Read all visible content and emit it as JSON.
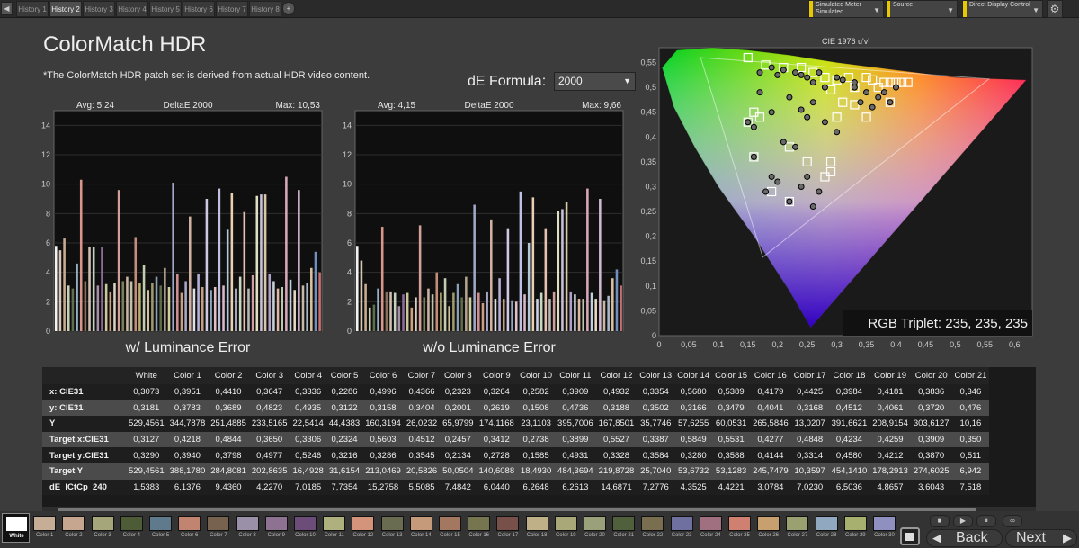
{
  "history": {
    "tabs": [
      "History 1",
      "History 2",
      "History 3",
      "History 4",
      "History 5",
      "History 6",
      "History 7",
      "History 8"
    ],
    "active": 1,
    "add_label": "+",
    "back_arrow": "◀"
  },
  "controls": {
    "meter_line1": "Simulated Meter",
    "meter_line2": "Simulated",
    "source": "Source",
    "display": "Direct Display Control",
    "gear": "⚙"
  },
  "header": {
    "title": "ColorMatch HDR",
    "note": "*The ColorMatch HDR patch set is derived from actual HDR video content.",
    "de_formula_label": "dE Formula:",
    "de_formula_value": "2000"
  },
  "chart_data": [
    {
      "type": "bar",
      "title": "DeltaE 2000",
      "avg": "Avg: 5,24",
      "max": "Max: 10,53",
      "xlabel": "w/ Luminance Error",
      "ylim": [
        0,
        15
      ],
      "yticks": [
        0,
        2,
        4,
        6,
        8,
        10,
        12,
        14
      ],
      "values": [
        5.8,
        5.5,
        6.3,
        3.1,
        2.9,
        4.6,
        10.3,
        3.4,
        5.7,
        5.7,
        3.1,
        5.7,
        3.2,
        2.7,
        3.3,
        9.6,
        3.4,
        3.7,
        3.4,
        6.4,
        3.3,
        4.5,
        2.8,
        3.3,
        3.7,
        3.1,
        4.3,
        3.0,
        10.1,
        3.9,
        2.6,
        3.4,
        7.8,
        2.9,
        3.9,
        3.0,
        9.0,
        2.8,
        3.0,
        9.7,
        3.1,
        6.9,
        9.4,
        2.9,
        3.7,
        8.1,
        2.9,
        3.8,
        9.2,
        9.3,
        9.3,
        3.9,
        3.4,
        2.9,
        3.0,
        10.5,
        3.5,
        2.8,
        9.6,
        3.1,
        3.3,
        4.3,
        5.4,
        4.0
      ],
      "colors": [
        "#f3f3f3",
        "#d8c6b6",
        "#c9ad90",
        "#c8d0b8",
        "#5d6e4a",
        "#95b0c8",
        "#d8968a",
        "#8b6e5a",
        "#cfc0b0",
        "#c6d0c0",
        "#a58fa8",
        "#8d6c9a",
        "#c8c898",
        "#cea080",
        "#d8d0c0",
        "#d2a098",
        "#78805a",
        "#c8b4a0",
        "#bec0a8",
        "#c68c7a",
        "#b8b070",
        "#c4ccb0",
        "#d0c4a0",
        "#a09a6a",
        "#8aa0b8",
        "#5f6a48",
        "#b2a290",
        "#cfcf9a",
        "#a0a8c8",
        "#d09090",
        "#c8a080",
        "#a8a8c8",
        "#d0b0a0",
        "#e0e0e0",
        "#b8b0d8",
        "#c0a080",
        "#d0c8e0",
        "#90a8c0",
        "#e0c0c0",
        "#c0c0e0",
        "#d8b8c8",
        "#b0c8d8",
        "#e8d0b0",
        "#d0d0e8",
        "#c8d8c0",
        "#e8c0b0",
        "#b8b8b8",
        "#d0a0a0",
        "#e0e0c0",
        "#c8c0d8",
        "#d8c8a8",
        "#b0a0c8",
        "#c8d0d8",
        "#e0b8a0",
        "#b8c8b0",
        "#d8a8b8",
        "#c0d0e0",
        "#e8d8c0",
        "#d0b8d0",
        "#c8b8a8",
        "#a8b8c8",
        "#d8c0a0",
        "#7090c0",
        "#c87070"
      ]
    },
    {
      "type": "bar",
      "title": "DeltaE 2000",
      "avg": "Avg: 4,15",
      "max": "Max: 9,66",
      "xlabel": "w/o Luminance Error",
      "ylim": [
        0,
        15
      ],
      "yticks": [
        0,
        2,
        4,
        6,
        8,
        10,
        12,
        14
      ],
      "values": [
        5.8,
        4.8,
        3.2,
        1.6,
        1.8,
        2.9,
        7.1,
        2.7,
        2.7,
        2.6,
        1.7,
        2.5,
        2.6,
        1.6,
        2.3,
        7.2,
        2.3,
        2.9,
        2.5,
        4.0,
        2.6,
        3.6,
        1.7,
        2.6,
        3.2,
        2.3,
        3.7,
        2.3,
        8.6,
        2.6,
        1.9,
        2.7,
        7.6,
        2.2,
        3.6,
        2.2,
        7.0,
        2.1,
        2.0,
        9.5,
        2.5,
        6.0,
        9.1,
        2.2,
        2.6,
        7.0,
        2.2,
        2.7,
        8.2,
        8.3,
        8.8,
        2.7,
        2.5,
        2.2,
        2.2,
        9.7,
        2.6,
        2.2,
        9.0,
        2.1,
        2.4,
        3.6,
        4.2,
        3.1
      ],
      "colors": [
        "#f3f3f3",
        "#d8c6b6",
        "#c9ad90",
        "#c8d0b8",
        "#5d6e4a",
        "#95b0c8",
        "#d8968a",
        "#8b6e5a",
        "#cfc0b0",
        "#c6d0c0",
        "#a58fa8",
        "#8d6c9a",
        "#c8c898",
        "#cea080",
        "#d8d0c0",
        "#d2a098",
        "#78805a",
        "#c8b4a0",
        "#bec0a8",
        "#c68c7a",
        "#b8b070",
        "#c4ccb0",
        "#d0c4a0",
        "#a09a6a",
        "#8aa0b8",
        "#5f6a48",
        "#b2a290",
        "#cfcf9a",
        "#a0a8c8",
        "#d09090",
        "#c8a080",
        "#a8a8c8",
        "#d0b0a0",
        "#e0e0e0",
        "#b8b0d8",
        "#c0a080",
        "#d0c8e0",
        "#90a8c0",
        "#e0c0c0",
        "#c0c0e0",
        "#d8b8c8",
        "#b0c8d8",
        "#e8d0b0",
        "#d0d0e8",
        "#c8d8c0",
        "#e8c0b0",
        "#b8b8b8",
        "#d0a0a0",
        "#e0e0c0",
        "#c8c0d8",
        "#d8c8a8",
        "#b0a0c8",
        "#c8d0d8",
        "#e0b8a0",
        "#b8c8b0",
        "#d8a8b8",
        "#c0d0e0",
        "#e8d8c0",
        "#d0b8d0",
        "#c8b8a8",
        "#a8b8c8",
        "#d8c0a0",
        "#7090c0",
        "#c87070"
      ]
    },
    {
      "type": "scatter",
      "title": "CIE 1976 u'v'",
      "xlim": [
        0,
        0.63
      ],
      "ylim": [
        0,
        0.58
      ],
      "xticks": [
        "0",
        "0,05",
        "0,1",
        "0,15",
        "0,2",
        "0,25",
        "0,3",
        "0,35",
        "0,4",
        "0,45",
        "0,5",
        "0,55",
        "0,6"
      ],
      "yticks": [
        "0",
        "0,05",
        "0,1",
        "0,15",
        "0,2",
        "0,25",
        "0,3",
        "0,35",
        "0,4",
        "0,45",
        "0,5",
        "0,55"
      ],
      "triplet_label": "RGB Triplet: 235, 235, 235",
      "measured": [
        [
          0.17,
          0.53
        ],
        [
          0.19,
          0.54
        ],
        [
          0.2,
          0.525
        ],
        [
          0.21,
          0.535
        ],
        [
          0.23,
          0.53
        ],
        [
          0.24,
          0.525
        ],
        [
          0.25,
          0.52
        ],
        [
          0.26,
          0.51
        ],
        [
          0.27,
          0.53
        ],
        [
          0.28,
          0.5
        ],
        [
          0.3,
          0.52
        ],
        [
          0.31,
          0.515
        ],
        [
          0.33,
          0.5
        ],
        [
          0.34,
          0.47
        ],
        [
          0.35,
          0.49
        ],
        [
          0.37,
          0.48
        ],
        [
          0.38,
          0.49
        ],
        [
          0.4,
          0.5
        ],
        [
          0.17,
          0.49
        ],
        [
          0.16,
          0.42
        ],
        [
          0.19,
          0.45
        ],
        [
          0.22,
          0.48
        ],
        [
          0.24,
          0.455
        ],
        [
          0.25,
          0.44
        ],
        [
          0.26,
          0.47
        ],
        [
          0.28,
          0.43
        ],
        [
          0.3,
          0.41
        ],
        [
          0.21,
          0.39
        ],
        [
          0.23,
          0.38
        ],
        [
          0.16,
          0.36
        ],
        [
          0.19,
          0.32
        ],
        [
          0.2,
          0.31
        ],
        [
          0.24,
          0.3
        ],
        [
          0.25,
          0.32
        ],
        [
          0.27,
          0.29
        ],
        [
          0.26,
          0.26
        ],
        [
          0.22,
          0.27
        ],
        [
          0.18,
          0.29
        ],
        [
          0.15,
          0.43
        ],
        [
          0.33,
          0.51
        ],
        [
          0.36,
          0.46
        ],
        [
          0.39,
          0.47
        ]
      ],
      "targets": [
        [
          0.15,
          0.56
        ],
        [
          0.18,
          0.545
        ],
        [
          0.21,
          0.54
        ],
        [
          0.24,
          0.54
        ],
        [
          0.26,
          0.53
        ],
        [
          0.28,
          0.52
        ],
        [
          0.3,
          0.515
        ],
        [
          0.32,
          0.52
        ],
        [
          0.33,
          0.5
        ],
        [
          0.35,
          0.52
        ],
        [
          0.36,
          0.515
        ],
        [
          0.38,
          0.51
        ],
        [
          0.4,
          0.51
        ],
        [
          0.42,
          0.51
        ],
        [
          0.29,
          0.495
        ],
        [
          0.31,
          0.47
        ],
        [
          0.33,
          0.465
        ],
        [
          0.35,
          0.44
        ],
        [
          0.39,
          0.47
        ],
        [
          0.41,
          0.51
        ],
        [
          0.16,
          0.45
        ],
        [
          0.17,
          0.44
        ],
        [
          0.16,
          0.36
        ],
        [
          0.22,
          0.38
        ],
        [
          0.25,
          0.35
        ],
        [
          0.29,
          0.35
        ],
        [
          0.28,
          0.32
        ],
        [
          0.29,
          0.33
        ],
        [
          0.19,
          0.29
        ],
        [
          0.22,
          0.27
        ],
        [
          0.15,
          0.43
        ],
        [
          0.37,
          0.5
        ],
        [
          0.3,
          0.44
        ],
        [
          0.39,
          0.51
        ]
      ]
    }
  ],
  "table": {
    "headers": [
      "",
      "White",
      "Color 1",
      "Color 2",
      "Color 3",
      "Color 4",
      "Color 5",
      "Color 6",
      "Color 7",
      "Color 8",
      "Color 9",
      "Color 10",
      "Color 11",
      "Color 12",
      "Color 13",
      "Color 14",
      "Color 15",
      "Color 16",
      "Color 17",
      "Color 18",
      "Color 19",
      "Color 20",
      "Color 21"
    ],
    "rows": [
      {
        "label": "x: CIE31",
        "values": [
          "0,3073",
          "0,3951",
          "0,4410",
          "0,3647",
          "0,3336",
          "0,2286",
          "0,4996",
          "0,4366",
          "0,2323",
          "0,3264",
          "0,2582",
          "0,3909",
          "0,4932",
          "0,3354",
          "0,5680",
          "0,5389",
          "0,4179",
          "0,4425",
          "0,3984",
          "0,4181",
          "0,3836",
          "0,346"
        ]
      },
      {
        "label": "y: CIE31",
        "values": [
          "0,3181",
          "0,3783",
          "0,3689",
          "0,4823",
          "0,4935",
          "0,3122",
          "0,3158",
          "0,3404",
          "0,2001",
          "0,2619",
          "0,1508",
          "0,4736",
          "0,3188",
          "0,3502",
          "0,3166",
          "0,3479",
          "0,4041",
          "0,3168",
          "0,4512",
          "0,4061",
          "0,3720",
          "0,476"
        ]
      },
      {
        "label": "Y",
        "values": [
          "529,4561",
          "344,7878",
          "251,4885",
          "233,5165",
          "22,5414",
          "44,4383",
          "160,3194",
          "26,0232",
          "65,9799",
          "174,1168",
          "23,1103",
          "395,7006",
          "167,8501",
          "35,7746",
          "57,6255",
          "60,0531",
          "265,5846",
          "13,0207",
          "391,6621",
          "208,9154",
          "303,6127",
          "10,16"
        ]
      },
      {
        "label": "Target x:CIE31",
        "values": [
          "0,3127",
          "0,4218",
          "0,4844",
          "0,3650",
          "0,3306",
          "0,2324",
          "0,5603",
          "0,4512",
          "0,2457",
          "0,3412",
          "0,2738",
          "0,3899",
          "0,5527",
          "0,3387",
          "0,5849",
          "0,5531",
          "0,4277",
          "0,4848",
          "0,4234",
          "0,4259",
          "0,3909",
          "0,350"
        ]
      },
      {
        "label": "Target y:CIE31",
        "values": [
          "0,3290",
          "0,3940",
          "0,3798",
          "0,4977",
          "0,5246",
          "0,3216",
          "0,3286",
          "0,3545",
          "0,2134",
          "0,2728",
          "0,1585",
          "0,4931",
          "0,3328",
          "0,3584",
          "0,3280",
          "0,3588",
          "0,4144",
          "0,3314",
          "0,4580",
          "0,4212",
          "0,3870",
          "0,511"
        ]
      },
      {
        "label": "Target Y",
        "values": [
          "529,4561",
          "388,1780",
          "284,8081",
          "202,8635",
          "16,4928",
          "31,6154",
          "213,0469",
          "20,5826",
          "50,0504",
          "140,6088",
          "18,4930",
          "484,3694",
          "219,8728",
          "25,7040",
          "53,6732",
          "53,1283",
          "245,7479",
          "10,3597",
          "454,1410",
          "178,2913",
          "274,6025",
          "6,942"
        ]
      },
      {
        "label": "dE_ICtCp_240",
        "values": [
          "1,5383",
          "6,1376",
          "9,4360",
          "4,2270",
          "7,0185",
          "7,7354",
          "15,2758",
          "5,5085",
          "7,4842",
          "6,0440",
          "6,2648",
          "6,2613",
          "14,6871",
          "7,2776",
          "4,3525",
          "4,4221",
          "3,0784",
          "7,0230",
          "6,5036",
          "4,8657",
          "3,6043",
          "7,518"
        ]
      }
    ]
  },
  "swatches": {
    "labels": [
      "White",
      "Color 1",
      "Color 2",
      "Color 3",
      "Color 4",
      "Color 5",
      "Color 6",
      "Color 7",
      "Color 8",
      "Color 9",
      "Color 10",
      "Color 11",
      "Color 12",
      "Color 13",
      "Color 14",
      "Color 15",
      "Color 16",
      "Color 17",
      "Color 18",
      "Color 19",
      "Color 20",
      "Color 21",
      "Color 22",
      "Color 23",
      "Color 24",
      "Color 25",
      "Color 26",
      "Color 27",
      "Color 28",
      "Color 29",
      "Color 30"
    ],
    "colors": [
      "#ffffff",
      "#c6ad95",
      "#c7a690",
      "#a5a77a",
      "#4d5b37",
      "#5f7a8c",
      "#c08470",
      "#77624f",
      "#9a90a8",
      "#8e7292",
      "#6c4c78",
      "#aeb07e",
      "#d4947c",
      "#6a6c52",
      "#c49a7a",
      "#a47860",
      "#757650",
      "#78504a",
      "#c0b088",
      "#a8a878",
      "#9aa07a",
      "#51603c",
      "#7a6e50",
      "#7070a0",
      "#a07080",
      "#d08070",
      "#c8a070",
      "#9aa070",
      "#90a8c0",
      "#a8b070",
      "#9090c0"
    ]
  },
  "player": {
    "back": "Back",
    "next": "Next",
    "buttons": [
      "■",
      "▶",
      "⏸",
      "∞"
    ]
  }
}
